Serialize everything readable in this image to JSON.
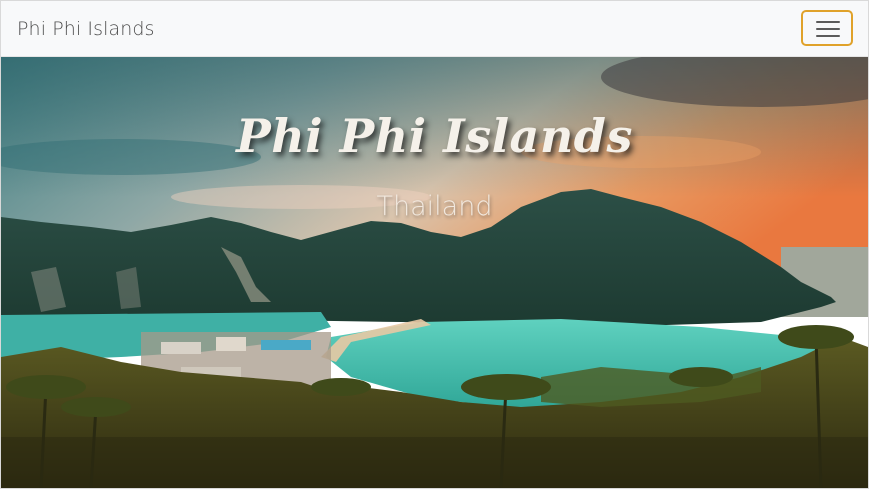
{
  "navbar": {
    "brand": "Phi Phi Islands",
    "toggle_icon": "hamburger-menu-icon",
    "toggle_border_color": "#e0a22a"
  },
  "hero": {
    "title": "Phi Phi Islands",
    "subtitle": "Thailand",
    "image": "landscape photo of the islands, bay with turquoise water, palm trees and sunset sky"
  }
}
